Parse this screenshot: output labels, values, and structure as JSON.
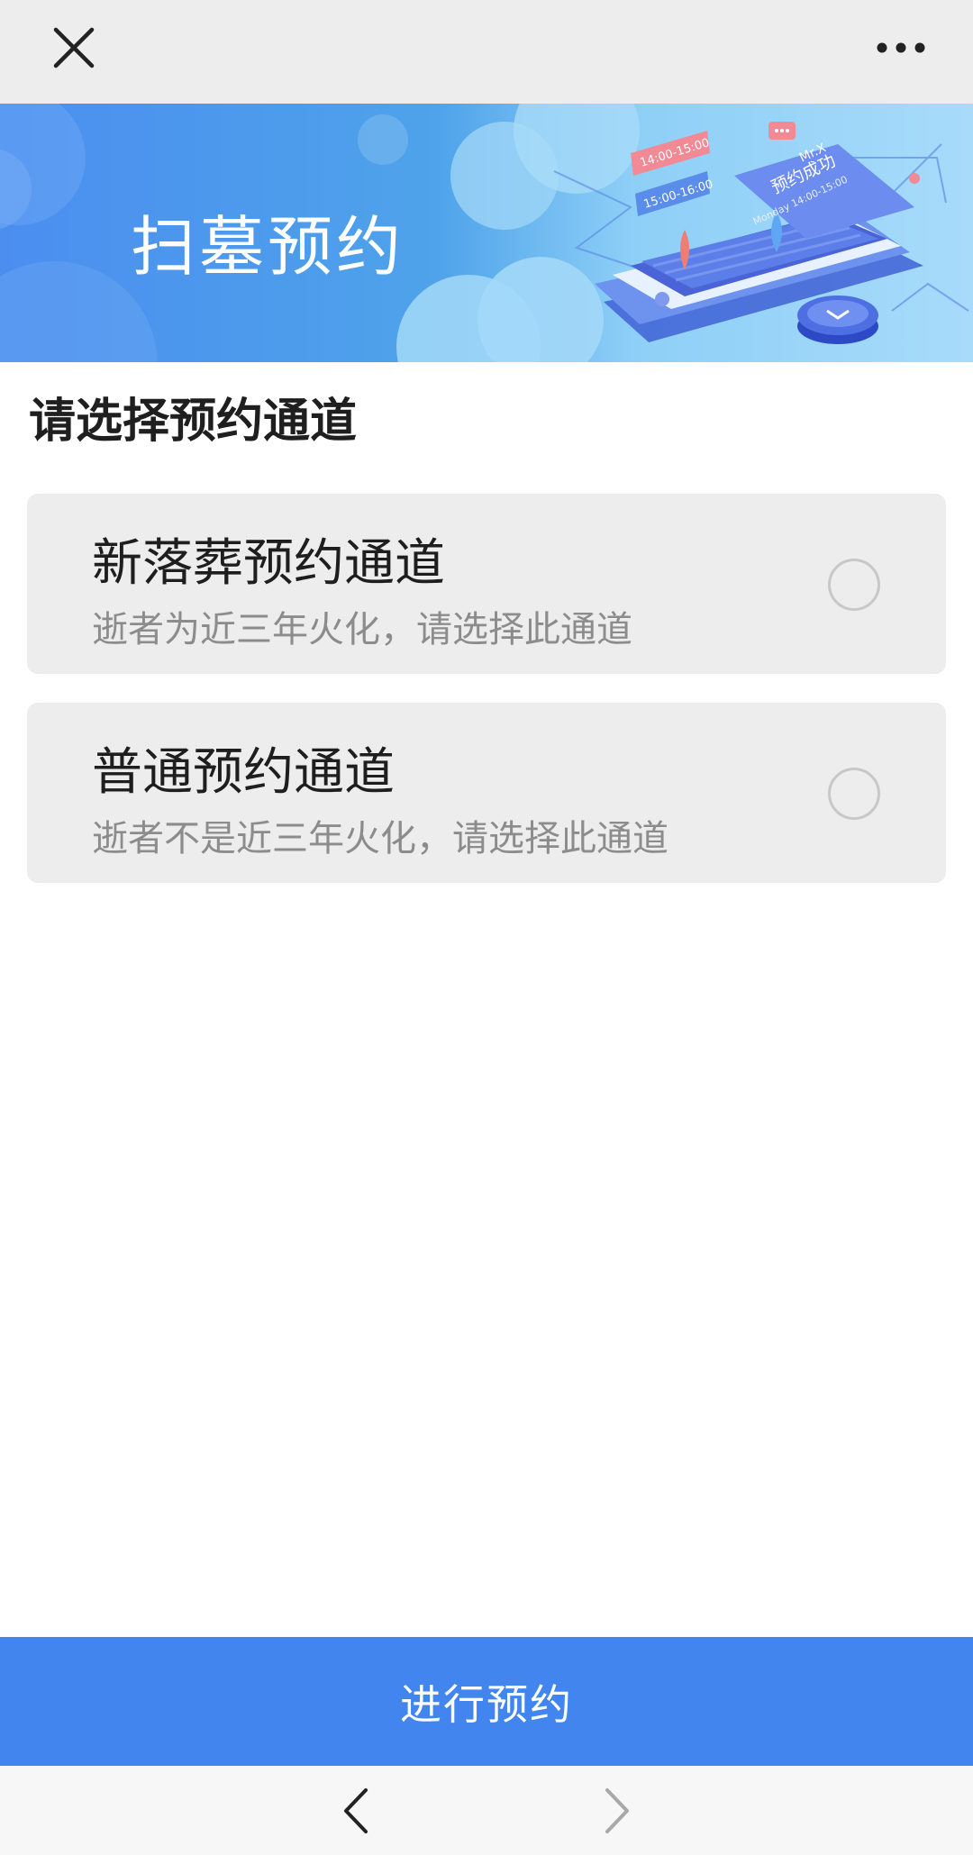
{
  "topbar": {
    "close_icon": "close-icon",
    "more_icon": "more-horizontal-icon"
  },
  "banner": {
    "title": "扫墓预约",
    "illustration_texts": {
      "slot1": "14:00-15:00",
      "slot2": "15:00-16:00",
      "card_user": "Mr.X",
      "card_status": "预约成功",
      "card_time": "Monday 14:00-15:00"
    }
  },
  "section": {
    "title": "请选择预约通道"
  },
  "options": [
    {
      "title": "新落葬预约通道",
      "description": "逝者为近三年火化，请选择此通道",
      "selected": false
    },
    {
      "title": "普通预约通道",
      "description": "逝者不是近三年火化，请选择此通道",
      "selected": false
    }
  ],
  "submit": {
    "label": "进行预约"
  },
  "bottom_nav": {
    "back_icon": "chevron-left-icon",
    "forward_icon": "chevron-right-icon"
  },
  "colors": {
    "accent": "#4285ee",
    "topbar_bg": "#ededed",
    "card_bg": "#ededed",
    "desc_text": "#8c8c8c"
  }
}
